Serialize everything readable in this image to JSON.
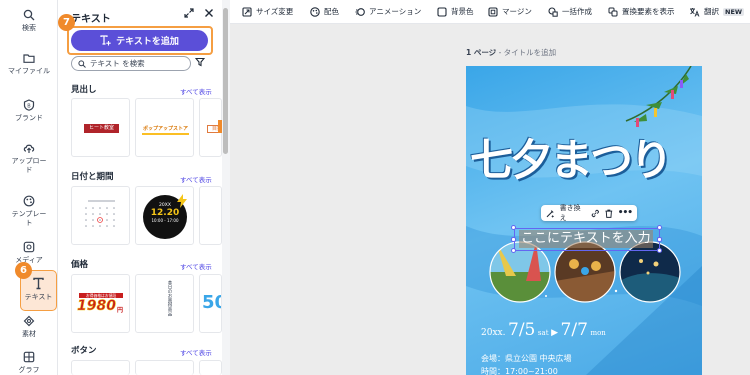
{
  "rail": {
    "items": [
      {
        "label": "検索",
        "icon": "search-icon"
      },
      {
        "label": "マイファイル",
        "icon": "folder-icon"
      },
      {
        "label": "ブランド",
        "icon": "brand-icon"
      },
      {
        "label": "アップロード",
        "icon": "upload-icon"
      },
      {
        "label": "テンプレート",
        "icon": "template-icon"
      },
      {
        "label": "メディア",
        "icon": "media-icon"
      },
      {
        "label": "テキスト",
        "icon": "text-icon"
      },
      {
        "label": "素材",
        "icon": "shapes-icon"
      },
      {
        "label": "グラフ",
        "icon": "chart-icon"
      }
    ],
    "step_badge": "6"
  },
  "panel": {
    "title": "テキスト",
    "add_text_label": "テキストを追加",
    "step_badge": "7",
    "search_placeholder": "テキスト を検索",
    "sections": {
      "headings": {
        "title": "見出し",
        "show_all": "すべて表示"
      },
      "dates": {
        "title": "日付と期間",
        "show_all": "すべて表示"
      },
      "price": {
        "title": "価格",
        "show_all": "すべて表示"
      },
      "buttons": {
        "title": "ボタン",
        "show_all": "すべて表示"
      }
    },
    "thumbs": {
      "heading_1": "ヒート教室",
      "heading_2": "ポップアップストア",
      "heading_3": "目録",
      "date_2_year": "20XX",
      "date_2_date": "12.20",
      "date_2_time": "10:00 - 17:00",
      "price_1_top": "お得価格はお値段",
      "price_1_value": "1980",
      "price_1_unit": "円",
      "price_2_text": "本日のお買得商品",
      "price_3_value": "50"
    }
  },
  "toolbar": {
    "items": [
      {
        "label": "サイズ変更",
        "icon": "resize-icon"
      },
      {
        "label": "配色",
        "icon": "palette-icon"
      },
      {
        "label": "アニメーション",
        "icon": "animation-icon"
      },
      {
        "label": "背景色",
        "icon": "bg-color-icon"
      },
      {
        "label": "マージン",
        "icon": "margin-icon"
      },
      {
        "label": "一括作成",
        "icon": "bulk-create-icon"
      },
      {
        "label": "置換要素を表示",
        "icon": "replace-icon"
      },
      {
        "label": "翻訳",
        "icon": "translate-icon"
      }
    ],
    "new_tag": "NEW"
  },
  "canvas": {
    "page_number": "1 ページ",
    "page_title_placeholder": "タイトルを追加",
    "float_bar_label": "書き換え",
    "selected_text": "ここにテキストを入力",
    "poster": {
      "title": "七夕まつり",
      "year": "20xx.",
      "start_date": "7/5",
      "start_day": "sat",
      "end_date": "7/7",
      "end_day": "mon",
      "venue_line": "会場：県立公園 中央広場",
      "time_line": "時間：17:00~21:00"
    }
  },
  "colors": {
    "accent": "#5b4fd8",
    "highlight": "#f59e42",
    "selection": "#6366f1",
    "poster_bg": "#3aa6e8"
  }
}
